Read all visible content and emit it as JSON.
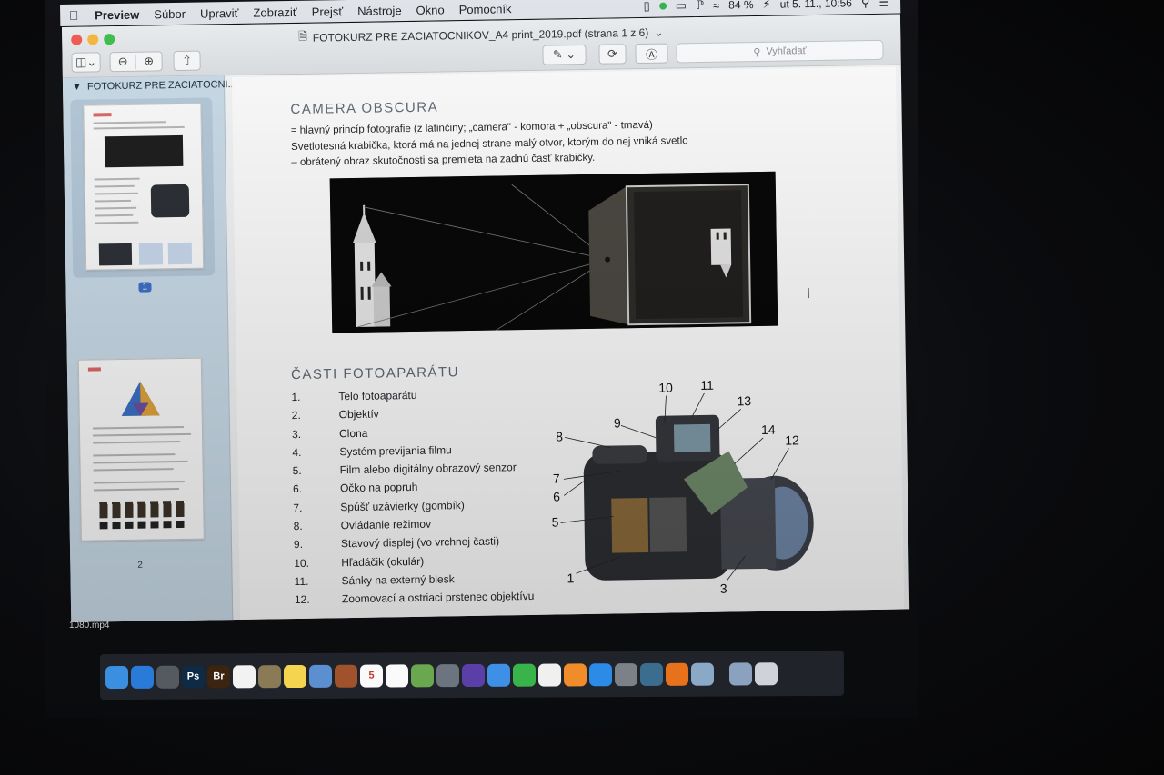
{
  "menubar": {
    "apple": "",
    "items": [
      {
        "label": "Preview",
        "app": true
      },
      {
        "label": "Súbor"
      },
      {
        "label": "Upraviť"
      },
      {
        "label": "Zobraziť"
      },
      {
        "label": "Prejsť"
      },
      {
        "label": "Nástroje"
      },
      {
        "label": "Okno"
      },
      {
        "label": "Pomocník"
      }
    ],
    "battery": "84 %",
    "clock": "ut 5. 11., 10:56"
  },
  "window": {
    "title": "FOTOKURZ PRE ZACIATOCNIKOV_A4 print_2019.pdf (strana 1 z 6)",
    "search_placeholder": "Vyhľadať"
  },
  "sidebar": {
    "header": "FOTOKURZ PRE ZACIATOCNI...",
    "pages": [
      "1",
      "2"
    ]
  },
  "document": {
    "obscura_title": "CAMERA OBSCURA",
    "obscura_def": "= hlavný princíp fotografie (z latinčiny; „camera\" - komora + „obscura\" - tmavá)",
    "obscura_desc1": "Svetlotesná krabička, ktorá má na jednej strane malý otvor, ktorým do nej vniká svetlo",
    "obscura_desc2": "– obrátený obraz skutočnosti sa premieta na zadnú časť krabičky.",
    "parts_title": "ČASTI FOTOAPARÁTU",
    "parts": [
      {
        "n": "1.",
        "label": "Telo fotoaparátu"
      },
      {
        "n": "2.",
        "label": "Objektív"
      },
      {
        "n": "3.",
        "label": "Clona"
      },
      {
        "n": "4.",
        "label": "Systém previjania filmu"
      },
      {
        "n": "5.",
        "label": "Film alebo digitálny obrazový senzor"
      },
      {
        "n": "6.",
        "label": "Očko na popruh"
      },
      {
        "n": "7.",
        "label": "Spúšť uzávierky (gombík)"
      },
      {
        "n": "8.",
        "label": "Ovládanie režimov"
      },
      {
        "n": "9.",
        "label": "Stavový displej (vo vrchnej časti)"
      },
      {
        "n": "10.",
        "label": "Hľadáčik (okulár)"
      },
      {
        "n": "11.",
        "label": "Sánky na externý blesk"
      },
      {
        "n": "12.",
        "label": "Zoomovací a ostriaci prstenec objektívu"
      }
    ],
    "diagram_labels": [
      "10",
      "11",
      "13",
      "9",
      "14",
      "8",
      "12",
      "7",
      "6",
      "5",
      "1",
      "3"
    ]
  },
  "desktop": {
    "file_label": "1080.mp4"
  },
  "dock": {
    "icons": [
      {
        "name": "finder-icon",
        "glyph": "",
        "color": "#3b8fe0"
      },
      {
        "name": "safari-icon",
        "glyph": "",
        "color": "#2a7bd8"
      },
      {
        "name": "photo-booth-icon",
        "glyph": "",
        "color": "#555a61"
      },
      {
        "name": "photoshop-icon",
        "glyph": "Ps",
        "color": "#0f2a44"
      },
      {
        "name": "bridge-icon",
        "glyph": "Br",
        "color": "#3d2410"
      },
      {
        "name": "photos-icon",
        "glyph": "",
        "color": "#f2f2f2"
      },
      {
        "name": "preview-icon",
        "glyph": "",
        "color": "#8a7a55"
      },
      {
        "name": "notes-icon",
        "glyph": "",
        "color": "#f5d550"
      },
      {
        "name": "mail-stamp-icon",
        "glyph": "",
        "color": "#5b8fd0"
      },
      {
        "name": "contacts-icon",
        "glyph": "",
        "color": "#a0522d"
      },
      {
        "name": "calendar-icon",
        "glyph": "5",
        "color": "#fafafa"
      },
      {
        "name": "reminders-icon",
        "glyph": "",
        "color": "#fafafa"
      },
      {
        "name": "maps-icon",
        "glyph": "",
        "color": "#6aa84f"
      },
      {
        "name": "launchpad-icon",
        "glyph": "",
        "color": "#6c7480"
      },
      {
        "name": "siri-icon",
        "glyph": "",
        "color": "#5a3fa8"
      },
      {
        "name": "messages-icon",
        "glyph": "",
        "color": "#3e8fe6"
      },
      {
        "name": "facetime-icon",
        "glyph": "",
        "color": "#39b44a"
      },
      {
        "name": "itunes-icon",
        "glyph": "",
        "color": "#f0f0f0"
      },
      {
        "name": "books-icon",
        "glyph": "",
        "color": "#f08c2a"
      },
      {
        "name": "app-store-icon",
        "glyph": "",
        "color": "#2b8be6"
      },
      {
        "name": "system-preferences-icon",
        "glyph": "",
        "color": "#7c8088"
      },
      {
        "name": "time-machine-icon",
        "glyph": "",
        "color": "#3a6d8e"
      },
      {
        "name": "vlc-icon",
        "glyph": "",
        "color": "#e8721c"
      },
      {
        "name": "image-capture-icon",
        "glyph": "",
        "color": "#8aa9c7"
      },
      {
        "name": "downloads-stack-icon",
        "glyph": "",
        "color": "#8aa2bf"
      },
      {
        "name": "trash-icon",
        "glyph": "",
        "color": "#cfd3d8"
      }
    ]
  }
}
